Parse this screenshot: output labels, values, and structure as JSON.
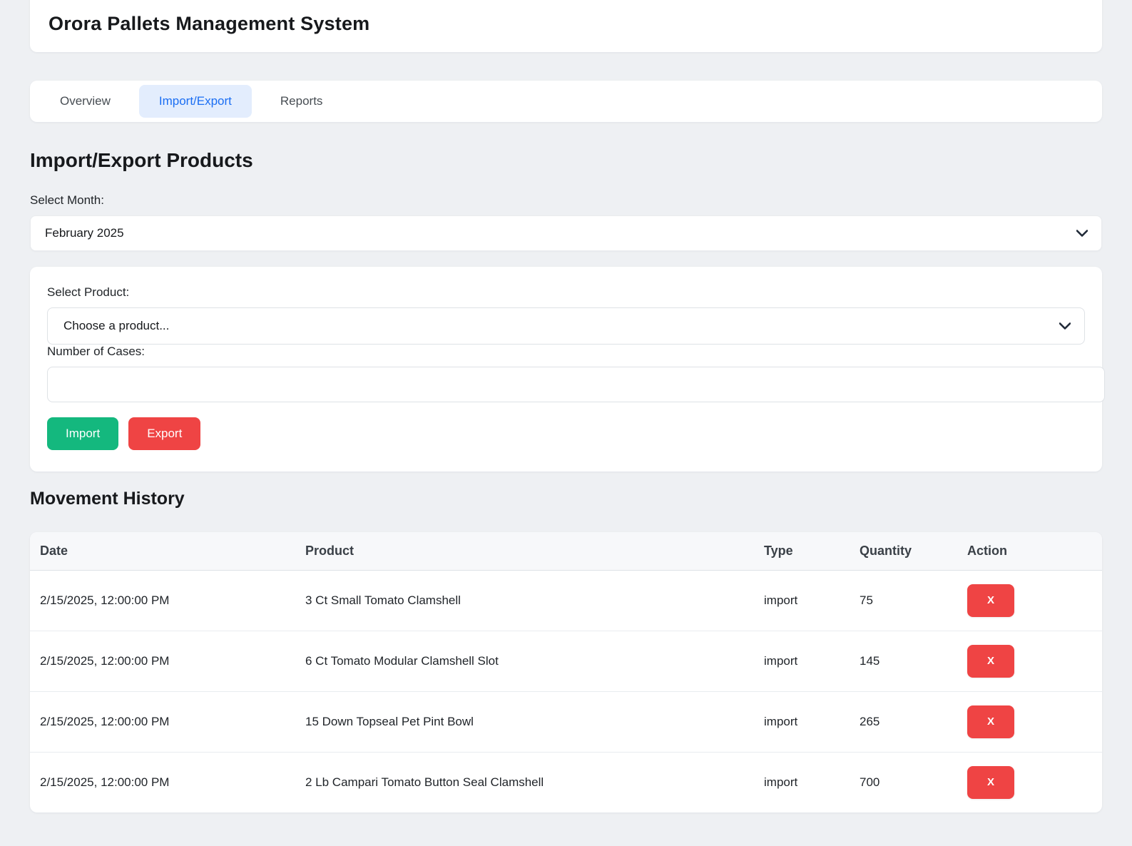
{
  "colors": {
    "page_bg": "#eef0f3",
    "accent_blue": "#1b6ef3",
    "active_tab_bg": "#e3edfd",
    "green": "#14b87e",
    "red": "#ef4444"
  },
  "header": {
    "title": "Orora Pallets Management System"
  },
  "tabs": [
    {
      "label": "Overview"
    },
    {
      "label": "Import/Export"
    },
    {
      "label": "Reports"
    }
  ],
  "import_export": {
    "heading": "Import/Export Products",
    "month": {
      "label": "Select Month:",
      "selected": "February 2025"
    },
    "form": {
      "product": {
        "label": "Select Product:",
        "selected": "Choose a product..."
      },
      "cases": {
        "label": "Number of Cases:",
        "value": ""
      },
      "buttons": {
        "import": "Import",
        "export": "Export"
      }
    }
  },
  "history": {
    "heading": "Movement History",
    "columns": [
      "Date",
      "Product",
      "Type",
      "Quantity",
      "Action"
    ],
    "delete_label": "X",
    "rows": [
      {
        "date": "2/15/2025, 12:00:00 PM",
        "product": "3 Ct Small Tomato Clamshell",
        "type": "import",
        "quantity": "75"
      },
      {
        "date": "2/15/2025, 12:00:00 PM",
        "product": "6 Ct Tomato Modular Clamshell Slot",
        "type": "import",
        "quantity": "145"
      },
      {
        "date": "2/15/2025, 12:00:00 PM",
        "product": "15 Down Topseal Pet Pint Bowl",
        "type": "import",
        "quantity": "265"
      },
      {
        "date": "2/15/2025, 12:00:00 PM",
        "product": "2 Lb Campari Tomato Button Seal Clamshell",
        "type": "import",
        "quantity": "700"
      }
    ]
  }
}
